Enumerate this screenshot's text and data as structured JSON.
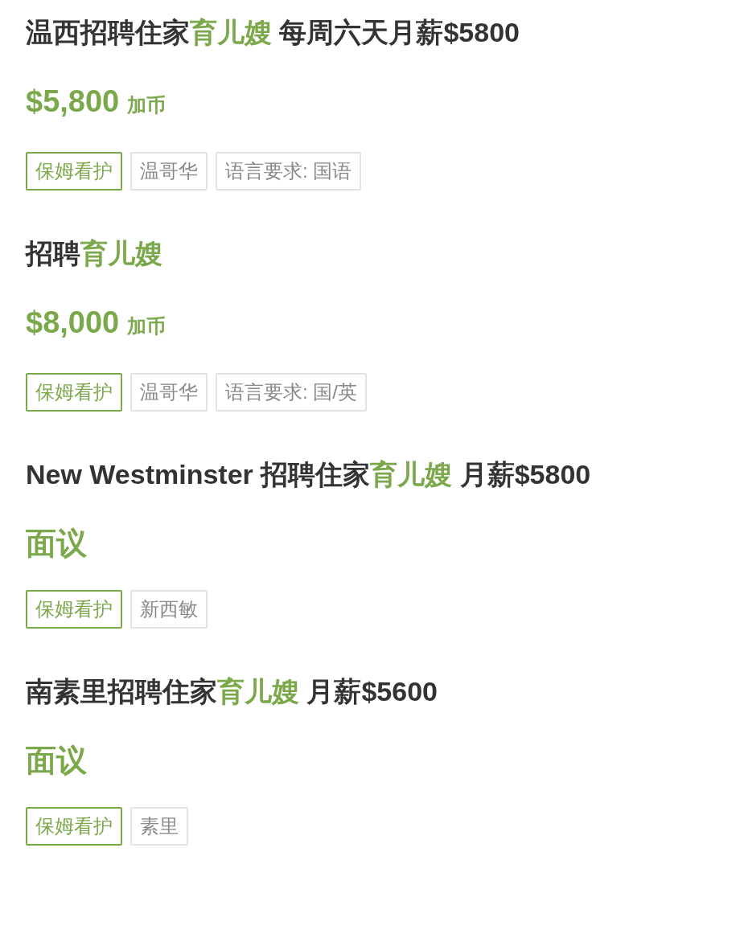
{
  "listings": [
    {
      "title": [
        {
          "text": "温西招聘住家",
          "highlight": false
        },
        {
          "text": "育儿嫂",
          "highlight": true
        },
        {
          "text": " 每周六天月薪$5800",
          "highlight": false
        }
      ],
      "price": "$5,800",
      "unit": "加币",
      "tags": [
        {
          "text": "保姆看护",
          "kind": "category"
        },
        {
          "text": "温哥华",
          "kind": "plain"
        },
        {
          "text": "语言要求: 国语",
          "kind": "plain"
        }
      ]
    },
    {
      "title": [
        {
          "text": "招聘",
          "highlight": false
        },
        {
          "text": "育儿嫂",
          "highlight": true
        }
      ],
      "price": "$8,000",
      "unit": "加币",
      "tags": [
        {
          "text": "保姆看护",
          "kind": "category"
        },
        {
          "text": "温哥华",
          "kind": "plain"
        },
        {
          "text": "语言要求: 国/英",
          "kind": "plain"
        }
      ]
    },
    {
      "title": [
        {
          "text": "New Westminster 招聘住家",
          "highlight": false
        },
        {
          "text": "育儿嫂",
          "highlight": true
        },
        {
          "text": " 月薪$5800",
          "highlight": false
        }
      ],
      "price": "面议",
      "tags": [
        {
          "text": "保姆看护",
          "kind": "category"
        },
        {
          "text": "新西敏",
          "kind": "plain"
        }
      ]
    },
    {
      "title": [
        {
          "text": "南素里招聘住家",
          "highlight": false
        },
        {
          "text": "育儿嫂",
          "highlight": true
        },
        {
          "text": " 月薪$5600",
          "highlight": false
        }
      ],
      "price": "面议",
      "tags": [
        {
          "text": "保姆看护",
          "kind": "category"
        },
        {
          "text": "素里",
          "kind": "plain"
        }
      ]
    }
  ]
}
